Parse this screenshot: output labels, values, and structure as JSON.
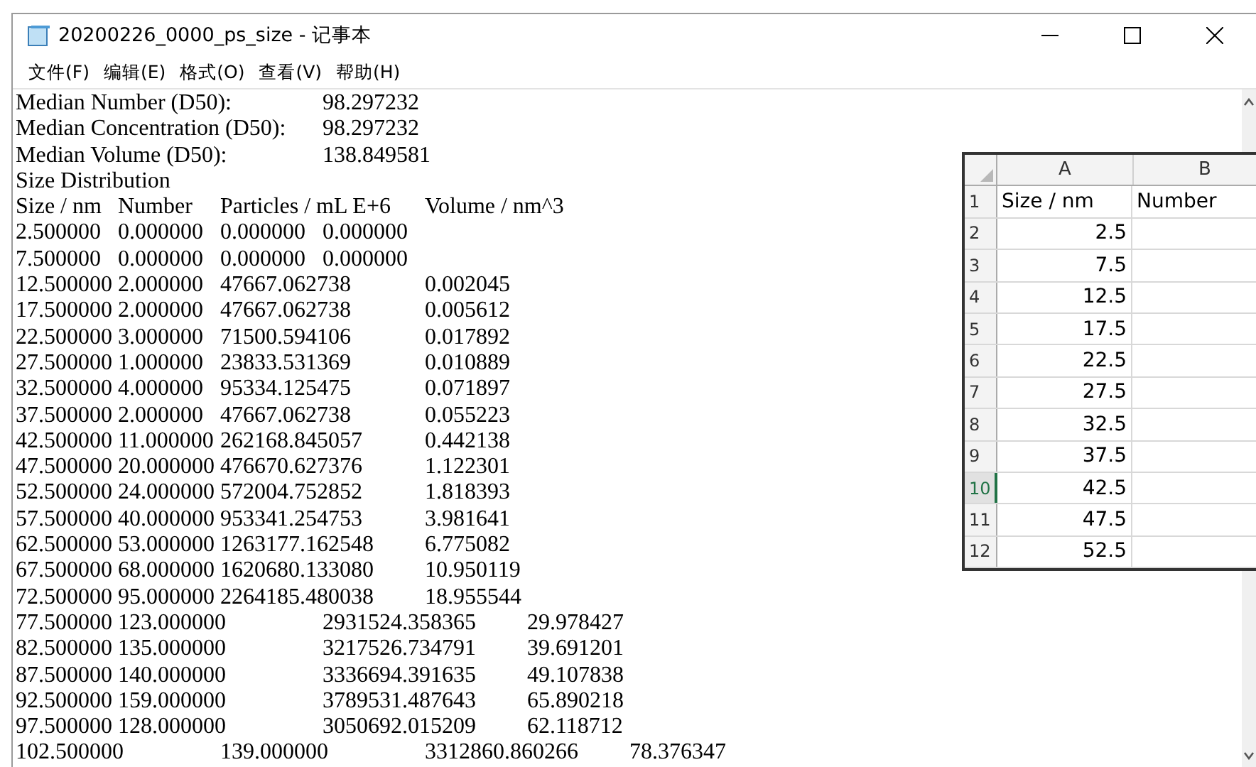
{
  "window": {
    "title": "20200226_0000_ps_size - 记事本"
  },
  "menu": [
    {
      "label": "文件(F)"
    },
    {
      "label": "编辑(E)"
    },
    {
      "label": "格式(O)"
    },
    {
      "label": "查看(V)"
    },
    {
      "label": "帮助(H)"
    }
  ],
  "text_lines": [
    "Median Number (D50):\t98.297232",
    "Median Concentration (D50):\t98.297232",
    "Median Volume (D50):\t138.849581",
    "Size Distribution",
    "Size / nm\tNumber\tParticles / mL E+6\tVolume / nm^3",
    "2.500000\t0.000000\t0.000000\t0.000000",
    "7.500000\t0.000000\t0.000000\t0.000000",
    "12.500000\t2.000000\t47667.062738\t0.002045",
    "17.500000\t2.000000\t47667.062738\t0.005612",
    "22.500000\t3.000000\t71500.594106\t0.017892",
    "27.500000\t1.000000\t23833.531369\t0.010889",
    "32.500000\t4.000000\t95334.125475\t0.071897",
    "37.500000\t2.000000\t47667.062738\t0.055223",
    "42.500000\t11.000000\t262168.845057\t0.442138",
    "47.500000\t20.000000\t476670.627376\t1.122301",
    "52.500000\t24.000000\t572004.752852\t1.818393",
    "57.500000\t40.000000\t953341.254753\t3.981641",
    "62.500000\t53.000000\t1263177.162548\t6.775082",
    "67.500000\t68.000000\t1620680.133080\t10.950119",
    "72.500000\t95.000000\t2264185.480038\t18.955544",
    "77.500000\t123.000000\t2931524.358365\t29.978427",
    "82.500000\t135.000000\t3217526.734791\t39.691201",
    "87.500000\t140.000000\t3336694.391635\t49.107838",
    "92.500000\t159.000000\t3789531.487643\t65.890218",
    "97.500000\t128.000000\t3050692.015209\t62.118712",
    "102.500000\t139.000000\t3312860.860266\t78.376347"
  ],
  "spreadsheet": {
    "columns": [
      "A",
      "B"
    ],
    "rows": [
      {
        "number": "1",
        "kind": "text",
        "cells": [
          "Size / nm",
          "Number"
        ],
        "selected": false
      },
      {
        "number": "2",
        "kind": "number",
        "cells": [
          "2.5"
        ],
        "selected": false
      },
      {
        "number": "3",
        "kind": "number",
        "cells": [
          "7.5"
        ],
        "selected": false
      },
      {
        "number": "4",
        "kind": "number",
        "cells": [
          "12.5"
        ],
        "selected": false
      },
      {
        "number": "5",
        "kind": "number",
        "cells": [
          "17.5"
        ],
        "selected": false
      },
      {
        "number": "6",
        "kind": "number",
        "cells": [
          "22.5"
        ],
        "selected": false
      },
      {
        "number": "7",
        "kind": "number",
        "cells": [
          "27.5"
        ],
        "selected": false
      },
      {
        "number": "8",
        "kind": "number",
        "cells": [
          "32.5"
        ],
        "selected": false
      },
      {
        "number": "9",
        "kind": "number",
        "cells": [
          "37.5"
        ],
        "selected": false
      },
      {
        "number": "10",
        "kind": "number",
        "cells": [
          "42.5"
        ],
        "selected": true
      },
      {
        "number": "11",
        "kind": "number",
        "cells": [
          "47.5"
        ],
        "selected": false
      },
      {
        "number": "12",
        "kind": "number",
        "cells": [
          "52.5"
        ],
        "selected": false
      }
    ]
  }
}
